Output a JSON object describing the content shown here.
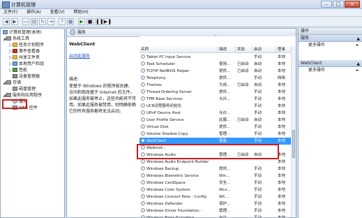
{
  "window": {
    "title": "计算机管理"
  },
  "menu": [
    "文件(F)",
    "操作(A)",
    "查看(V)",
    "帮助(H)"
  ],
  "tree": {
    "root": "计算机管理(本地)",
    "items": [
      {
        "label": "系统工具",
        "level": 1,
        "toggle": "◢"
      },
      {
        "label": "任务计划程序",
        "level": 2,
        "toggle": "▷"
      },
      {
        "label": "事件查看器",
        "level": 2,
        "toggle": "▷"
      },
      {
        "label": "共享文件夹",
        "level": 2,
        "toggle": "▷"
      },
      {
        "label": "本地用户和组",
        "level": 2,
        "toggle": "▷"
      },
      {
        "label": "性能",
        "level": 2,
        "toggle": "▷"
      },
      {
        "label": "设备管理器",
        "level": 2,
        "toggle": ""
      },
      {
        "label": "存储",
        "level": 1,
        "toggle": "◢"
      },
      {
        "label": "磁盘管理",
        "level": 2,
        "toggle": ""
      },
      {
        "label": "服务和应用程序",
        "level": 1,
        "toggle": "◢"
      },
      {
        "label": "服务",
        "level": 2,
        "toggle": ""
      },
      {
        "label": "WMI 控件",
        "level": 2,
        "toggle": ""
      }
    ]
  },
  "services_panel": {
    "header": "服务",
    "selected_name": "WebClient",
    "action_link": "启动此服务",
    "desc_label": "描述:",
    "description": "使基于 Windows 的程序能创建、访问和修改基于 Internet 的文件。如果此服务被停止，这些功能将不可用。如果此服务被禁用，则明确依赖它的所有服务都将无法启动。"
  },
  "columns": [
    "名称",
    "描述",
    "状态",
    "启动",
    "登录"
  ],
  "rows": [
    {
      "name": "Tablet PC Input Service",
      "desc": "",
      "status": "",
      "startup": "手动",
      "logon": "本地"
    },
    {
      "name": "Task Scheduler",
      "desc": "使用...",
      "status": "已启动",
      "startup": "自动",
      "logon": "本地"
    },
    {
      "name": "TCP/IP NetBIOS Helper",
      "desc": "提供...",
      "status": "已启动",
      "startup": "自动",
      "logon": "本地"
    },
    {
      "name": "Telephony",
      "desc": "提供...",
      "status": "",
      "startup": "手动",
      "logon": "网络"
    },
    {
      "name": "Themes",
      "desc": "为用...",
      "status": "已启动",
      "startup": "自动",
      "logon": "本地"
    },
    {
      "name": "Thread Ordering Server",
      "desc": "提供...",
      "status": "",
      "startup": "手动",
      "logon": "本地"
    },
    {
      "name": "TPM Base Services",
      "desc": "允许...",
      "status": "",
      "startup": "手动",
      "logon": "本地"
    },
    {
      "name": "UCB远程服务初始化",
      "desc": "",
      "status": "",
      "startup": "手动",
      "logon": "本地"
    },
    {
      "name": "UPnP Device Host",
      "desc": "允许...",
      "status": "",
      "startup": "手动",
      "logon": "本地"
    },
    {
      "name": "User Profile Service",
      "desc": "此服...",
      "status": "已启动",
      "startup": "自动",
      "logon": "本地"
    },
    {
      "name": "Virtual Disk",
      "desc": "提供...",
      "status": "",
      "startup": "手动",
      "logon": "本地"
    },
    {
      "name": "Volume Shadow Copy",
      "desc": "管理...",
      "status": "",
      "startup": "手动",
      "logon": "本地"
    },
    {
      "name": "WebClient",
      "desc": "使基...",
      "status": "",
      "startup": "手动",
      "logon": "本地"
    },
    {
      "name": "Webroot...",
      "desc": "",
      "status": "",
      "startup": "",
      "logon": ""
    },
    {
      "name": "Windows Audio",
      "desc": "管理...",
      "status": "已启动",
      "startup": "自动",
      "logon": "本地"
    },
    {
      "name": "Windows Audio Endpoint Builder",
      "desc": "",
      "status": "",
      "startup": "",
      "logon": "本地"
    },
    {
      "name": "Windows Backup",
      "desc": "提供...",
      "status": "",
      "startup": "手动",
      "logon": "本地"
    },
    {
      "name": "Windows Biometric Service",
      "desc": "Win...",
      "status": "",
      "startup": "手动",
      "logon": "本地"
    },
    {
      "name": "Windows CardSpace",
      "desc": "安全...",
      "status": "",
      "startup": "手动",
      "logon": "本地"
    },
    {
      "name": "Windows Color System",
      "desc": "Wcs...",
      "status": "",
      "startup": "手动",
      "logon": "本地"
    },
    {
      "name": "Windows Connect Now - Config",
      "desc": "WC...",
      "status": "",
      "startup": "手动",
      "logon": "本地"
    },
    {
      "name": "Windows Defender",
      "desc": "保护...",
      "status": "",
      "startup": "手动",
      "logon": "本地"
    },
    {
      "name": "Windows Driver Foundation -",
      "desc": "管理...",
      "status": "",
      "startup": "手动",
      "logon": "本地"
    },
    {
      "name": "Windows Error Reporting",
      "desc": "允许...",
      "status": "",
      "startup": "手动",
      "logon": "本地"
    }
  ],
  "actions": {
    "title": "操作",
    "sections": [
      {
        "title": "服务",
        "items": [
          "更多操作"
        ]
      },
      {
        "title": "WebClient",
        "items": [
          "更多操作"
        ]
      }
    ]
  }
}
